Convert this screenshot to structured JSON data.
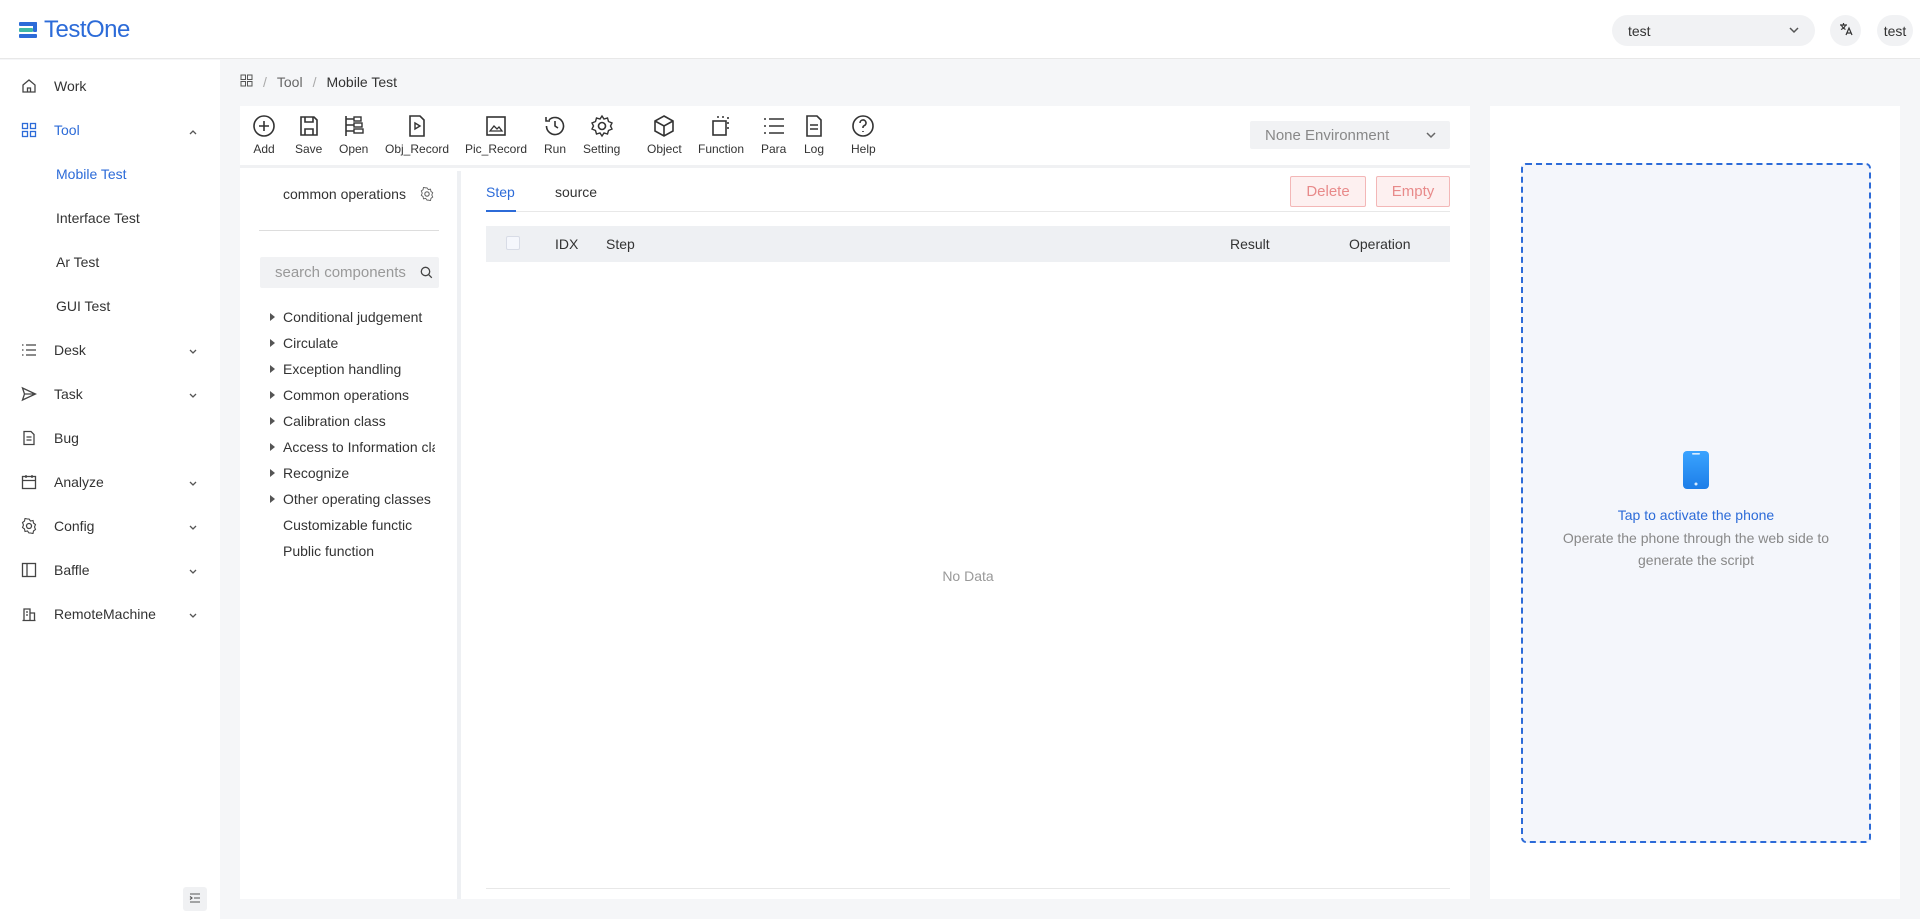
{
  "app": {
    "name": "TestOne"
  },
  "header": {
    "project": "test",
    "user": "test"
  },
  "sidebar": {
    "items": [
      {
        "label": "Work"
      },
      {
        "label": "Tool"
      },
      {
        "label": "Desk"
      },
      {
        "label": "Task"
      },
      {
        "label": "Bug"
      },
      {
        "label": "Analyze"
      },
      {
        "label": "Config"
      },
      {
        "label": "Baffle"
      },
      {
        "label": "RemoteMachine"
      }
    ],
    "tool_sub": [
      {
        "label": "Mobile Test"
      },
      {
        "label": "Interface Test"
      },
      {
        "label": "Ar Test"
      },
      {
        "label": "GUI Test"
      }
    ]
  },
  "breadcrumb": {
    "items": [
      "Tool",
      "Mobile Test"
    ]
  },
  "toolbar": {
    "buttons": [
      {
        "label": "Add"
      },
      {
        "label": "Save"
      },
      {
        "label": "Open"
      },
      {
        "label": "Obj_Record"
      },
      {
        "label": "Pic_Record"
      },
      {
        "label": "Run"
      },
      {
        "label": "Setting"
      },
      {
        "label": "Object"
      },
      {
        "label": "Function"
      },
      {
        "label": "Para"
      },
      {
        "label": "Log"
      },
      {
        "label": "Help"
      }
    ],
    "environment": "None Environment"
  },
  "components": {
    "title": "common operations",
    "search_placeholder": "search components",
    "tree": [
      {
        "label": "Conditional judgement"
      },
      {
        "label": "Circulate"
      },
      {
        "label": "Exception handling"
      },
      {
        "label": "Common operations"
      },
      {
        "label": "Calibration class"
      },
      {
        "label": "Access to Information cla"
      },
      {
        "label": "Recognize"
      },
      {
        "label": "Other operating classes"
      },
      {
        "label": "Customizable functic"
      },
      {
        "label": "Public function"
      }
    ]
  },
  "steps": {
    "tabs": [
      {
        "label": "Step"
      },
      {
        "label": "source"
      }
    ],
    "delete_label": "Delete",
    "empty_label": "Empty",
    "columns": {
      "idx": "IDX",
      "step": "Step",
      "result": "Result",
      "operation": "Operation"
    },
    "rows": [],
    "empty_text": "No Data"
  },
  "phone": {
    "title": "Tap to activate the phone",
    "description": "Operate the phone through the web side to generate the script"
  },
  "colors": {
    "accent": "#2c6bd8",
    "danger": "#e88a8a"
  }
}
